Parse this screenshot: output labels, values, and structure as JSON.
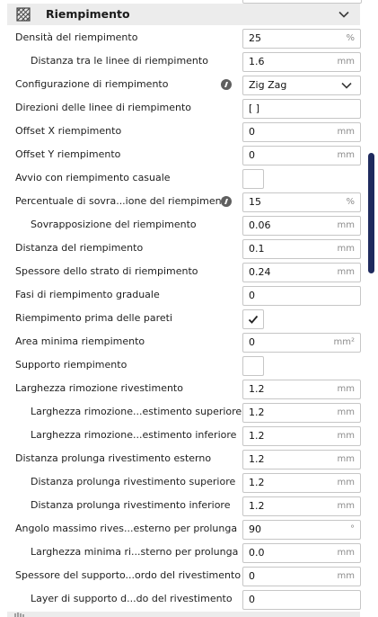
{
  "section": {
    "title": "Riempimento",
    "icon": "infill-grid-icon",
    "chevron_icon": "chevron-down-icon"
  },
  "rows": [
    {
      "label": "Densità del riempimento",
      "value": "25",
      "unit": "%",
      "kind": "field",
      "indent": 0
    },
    {
      "label": "Distanza tra le linee di riempimento",
      "value": "1.6",
      "unit": "mm",
      "kind": "field",
      "indent": 1
    },
    {
      "label": "Configurazione di riempimento",
      "value": "Zig Zag",
      "unit": "",
      "kind": "dropdown",
      "indent": 0,
      "info": true
    },
    {
      "label": "Direzioni delle linee di riempimento",
      "value": "[ ]",
      "unit": "",
      "kind": "field",
      "indent": 0
    },
    {
      "label": "Offset X riempimento",
      "value": "0",
      "unit": "mm",
      "kind": "field",
      "indent": 0
    },
    {
      "label": "Offset Y riempimento",
      "value": "0",
      "unit": "mm",
      "kind": "field",
      "indent": 0
    },
    {
      "label": "Avvio con riempimento casuale",
      "value": "",
      "unit": "",
      "kind": "checkbox",
      "checked": false,
      "indent": 0
    },
    {
      "label": "Percentuale di sovra...ione del riempimento",
      "value": "15",
      "unit": "%",
      "kind": "field",
      "indent": 0,
      "info": true
    },
    {
      "label": "Sovrapposizione del riempimento",
      "value": "0.06",
      "unit": "mm",
      "kind": "field",
      "indent": 1
    },
    {
      "label": "Distanza del riempimento",
      "value": "0.1",
      "unit": "mm",
      "kind": "field",
      "indent": 0
    },
    {
      "label": "Spessore dello strato di riempimento",
      "value": "0.24",
      "unit": "mm",
      "kind": "field",
      "indent": 0
    },
    {
      "label": "Fasi di riempimento graduale",
      "value": "0",
      "unit": "",
      "kind": "field",
      "indent": 0
    },
    {
      "label": "Riempimento prima delle pareti",
      "value": "",
      "unit": "",
      "kind": "checkbox",
      "checked": true,
      "indent": 0
    },
    {
      "label": "Area minima riempimento",
      "value": "0",
      "unit": "mm²",
      "kind": "field",
      "indent": 0
    },
    {
      "label": "Supporto riempimento",
      "value": "",
      "unit": "",
      "kind": "checkbox",
      "checked": false,
      "indent": 0
    },
    {
      "label": "Larghezza rimozione rivestimento",
      "value": "1.2",
      "unit": "mm",
      "kind": "field",
      "indent": 0
    },
    {
      "label": "Larghezza rimozione...estimento superiore",
      "value": "1.2",
      "unit": "mm",
      "kind": "field",
      "indent": 1
    },
    {
      "label": "Larghezza rimozione...estimento inferiore",
      "value": "1.2",
      "unit": "mm",
      "kind": "field",
      "indent": 1
    },
    {
      "label": "Distanza prolunga rivestimento esterno",
      "value": "1.2",
      "unit": "mm",
      "kind": "field",
      "indent": 0
    },
    {
      "label": "Distanza prolunga rivestimento superiore",
      "value": "1.2",
      "unit": "mm",
      "kind": "field",
      "indent": 1
    },
    {
      "label": "Distanza prolunga rivestimento inferiore",
      "value": "1.2",
      "unit": "mm",
      "kind": "field",
      "indent": 1
    },
    {
      "label": "Angolo massimo rives...esterno per prolunga",
      "value": "90",
      "unit": "°",
      "kind": "field",
      "indent": 0
    },
    {
      "label": "Larghezza minima ri...sterno per prolunga",
      "value": "0.0",
      "unit": "mm",
      "kind": "field",
      "indent": 1
    },
    {
      "label": "Spessore del supporto...ordo del rivestimento",
      "value": "0",
      "unit": "mm",
      "kind": "field",
      "indent": 0
    },
    {
      "label": "Layer di supporto d...do del rivestimento",
      "value": "0",
      "unit": "",
      "kind": "field",
      "indent": 1
    }
  ]
}
